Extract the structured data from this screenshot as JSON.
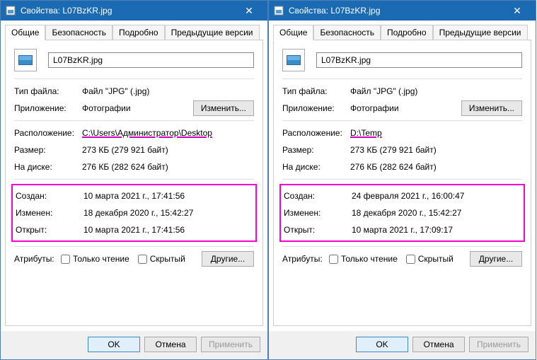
{
  "dialogs": [
    {
      "title": "Свойства: L07BzKR.jpg",
      "tabs": [
        "Общие",
        "Безопасность",
        "Подробно",
        "Предыдущие версии"
      ],
      "activeTab": 0,
      "fileName": "L07BzKR.jpg",
      "labels": {
        "fileType": "Тип файла:",
        "app": "Приложение:",
        "location": "Расположение:",
        "size": "Размер:",
        "onDisk": "На диске:",
        "created": "Создан:",
        "modified": "Изменен:",
        "accessed": "Открыт:",
        "attributes": "Атрибуты:"
      },
      "values": {
        "fileType": "Файл \"JPG\" (.jpg)",
        "app": "Фотографии",
        "location": "C:\\Users\\Администратор\\Desktop",
        "size": "273 КБ (279 921 байт)",
        "onDisk": "276 КБ (282 624 байт)",
        "created": "10 марта 2021 г., 17:41:56",
        "modified": "18 декабря 2020 г., 15:42:27",
        "accessed": "10 марта 2021 г., 17:41:56"
      },
      "buttons": {
        "change": "Изменить...",
        "other": "Другие...",
        "ok": "OK",
        "cancel": "Отмена",
        "apply": "Применить"
      },
      "checkboxes": {
        "readonly": "Только чтение",
        "hidden": "Скрытый"
      }
    },
    {
      "title": "Свойства: L07BzKR.jpg",
      "tabs": [
        "Общие",
        "Безопасность",
        "Подробно",
        "Предыдущие версии"
      ],
      "activeTab": 0,
      "fileName": "L07BzKR.jpg",
      "labels": {
        "fileType": "Тип файла:",
        "app": "Приложение:",
        "location": "Расположение:",
        "size": "Размер:",
        "onDisk": "На диске:",
        "created": "Создан:",
        "modified": "Изменен:",
        "accessed": "Открыт:",
        "attributes": "Атрибуты:"
      },
      "values": {
        "fileType": "Файл \"JPG\" (.jpg)",
        "app": "Фотографии",
        "location": "D:\\Temp",
        "size": "273 КБ (279 921 байт)",
        "onDisk": "276 КБ (282 624 байт)",
        "created": "24 февраля 2021 г., 16:00:47",
        "modified": "18 декабря 2020 г., 15:42:27",
        "accessed": "10 марта 2021 г., 17:09:17"
      },
      "buttons": {
        "change": "Изменить...",
        "other": "Другие...",
        "ok": "OK",
        "cancel": "Отмена",
        "apply": "Применить"
      },
      "checkboxes": {
        "readonly": "Только чтение",
        "hidden": "Скрытый"
      }
    }
  ]
}
